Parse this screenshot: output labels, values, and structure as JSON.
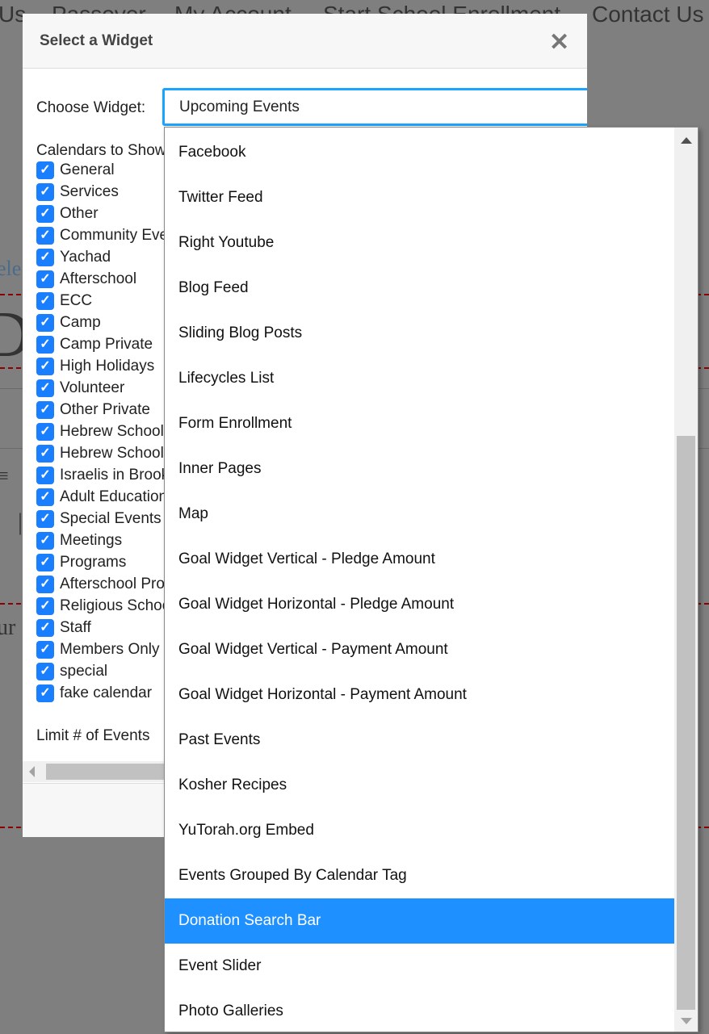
{
  "background": {
    "nav": [
      "Us",
      "Passover",
      "My Account",
      "Start School Enrollment",
      "Contact Us"
    ],
    "fragments": [
      "ele",
      "D",
      "≡",
      "|",
      "ur"
    ]
  },
  "modal": {
    "title": "Select a Widget",
    "close_icon": "close-x-icon",
    "choose_label": "Choose Widget:",
    "selected_widget": "Upcoming Events",
    "calendars_label": "Calendars to Show",
    "calendars": [
      "General",
      "Services",
      "Other",
      "Community Events",
      "Yachad",
      "Afterschool",
      "ECC",
      "Camp",
      "Camp Private",
      "High Holidays",
      "Volunteer",
      "Other Private",
      "Hebrew School",
      "Hebrew School",
      "Israelis in Brooklyn",
      "Adult Education",
      "Special Events",
      "Meetings",
      "Programs",
      "Afterschool Programs",
      "Religious School",
      "Staff",
      "Members Only",
      "special",
      "fake calendar"
    ],
    "limit_label": "Limit # of Events"
  },
  "dropdown": {
    "highlight_color": "#1e90ff",
    "highlighted": "Donation Search Bar",
    "options": [
      "Facebook",
      "Twitter Feed",
      "Right Youtube",
      "Blog Feed",
      "Sliding Blog Posts",
      "Lifecycles List",
      "Form Enrollment",
      "Inner Pages",
      "Map",
      "Goal Widget Vertical - Pledge Amount",
      "Goal Widget Horizontal - Pledge Amount",
      "Goal Widget Vertical - Payment Amount",
      "Goal Widget Horizontal - Payment Amount",
      "Past Events",
      "Kosher Recipes",
      "YuTorah.org Embed",
      "Events Grouped By Calendar Tag",
      "Donation Search Bar",
      "Event Slider",
      "Photo Galleries"
    ]
  }
}
